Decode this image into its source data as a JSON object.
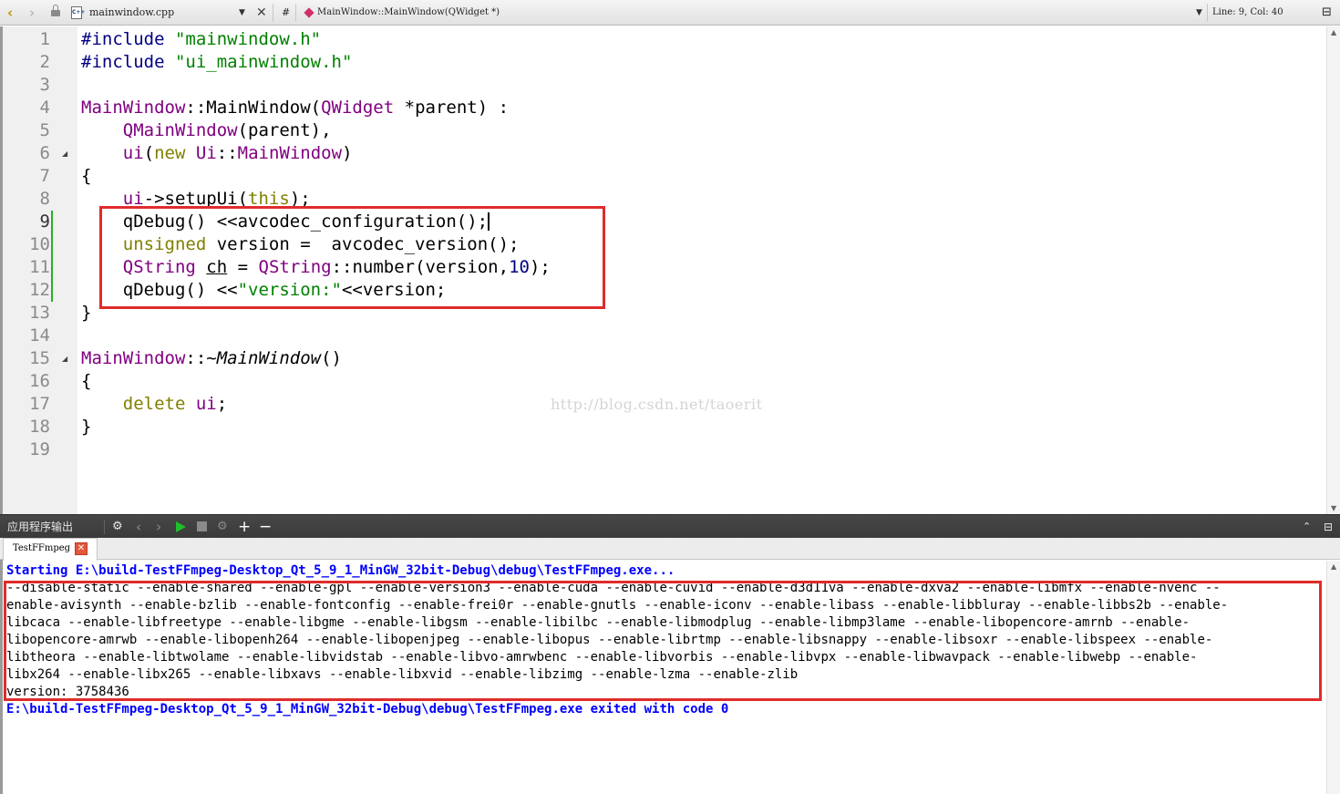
{
  "toolbar": {
    "file_name": "mainwindow.cpp",
    "file_icon_label": "C++",
    "hash": "#",
    "symbol": "MainWindow::MainWindow(QWidget *)",
    "cursor_position": "Line: 9, Col: 40"
  },
  "editor": {
    "line_numbers": [
      "1",
      "2",
      "3",
      "4",
      "5",
      "6",
      "7",
      "8",
      "9",
      "10",
      "11",
      "12",
      "13",
      "14",
      "15",
      "16",
      "17",
      "18",
      "19"
    ],
    "current_line": "9",
    "lines": [
      [
        {
          "t": "#include ",
          "c": "pp"
        },
        {
          "t": "\"mainwindow.h\"",
          "c": "str"
        }
      ],
      [
        {
          "t": "#include ",
          "c": "pp"
        },
        {
          "t": "\"ui_mainwindow.h\"",
          "c": "str"
        }
      ],
      [],
      [
        {
          "t": "MainWindow",
          "c": "ty"
        },
        {
          "t": "::MainWindow(",
          "c": ""
        },
        {
          "t": "QWidget",
          "c": "ty"
        },
        {
          "t": " *parent) :",
          "c": ""
        }
      ],
      [
        {
          "t": "    ",
          "c": ""
        },
        {
          "t": "QMainWindow",
          "c": "ty"
        },
        {
          "t": "(parent),",
          "c": ""
        }
      ],
      [
        {
          "t": "    ",
          "c": ""
        },
        {
          "t": "ui",
          "c": "ty"
        },
        {
          "t": "(",
          "c": ""
        },
        {
          "t": "new",
          "c": "kw"
        },
        {
          "t": " ",
          "c": ""
        },
        {
          "t": "Ui",
          "c": "ty"
        },
        {
          "t": "::",
          "c": ""
        },
        {
          "t": "MainWindow",
          "c": "ty"
        },
        {
          "t": ")",
          "c": ""
        }
      ],
      [
        {
          "t": "{",
          "c": ""
        }
      ],
      [
        {
          "t": "    ",
          "c": ""
        },
        {
          "t": "ui",
          "c": "ty"
        },
        {
          "t": "->setupUi(",
          "c": ""
        },
        {
          "t": "this",
          "c": "kw"
        },
        {
          "t": ");",
          "c": ""
        }
      ],
      [
        {
          "t": "    qDebug() <<avcodec_configuration();",
          "c": ""
        },
        {
          "t": "",
          "c": "caret"
        }
      ],
      [
        {
          "t": "    ",
          "c": ""
        },
        {
          "t": "unsigned",
          "c": "kw"
        },
        {
          "t": " version =  avcodec_version();",
          "c": ""
        }
      ],
      [
        {
          "t": "    ",
          "c": ""
        },
        {
          "t": "QString",
          "c": "ty"
        },
        {
          "t": " ",
          "c": ""
        },
        {
          "t": "ch",
          "c": "ul"
        },
        {
          "t": " = ",
          "c": ""
        },
        {
          "t": "QString",
          "c": "ty"
        },
        {
          "t": "::number(version,",
          "c": ""
        },
        {
          "t": "10",
          "c": "num"
        },
        {
          "t": ");",
          "c": ""
        }
      ],
      [
        {
          "t": "    qDebug() <<",
          "c": ""
        },
        {
          "t": "\"version:\"",
          "c": "str"
        },
        {
          "t": "<<version;",
          "c": ""
        }
      ],
      [
        {
          "t": "}",
          "c": ""
        }
      ],
      [],
      [
        {
          "t": "MainWindow",
          "c": "ty"
        },
        {
          "t": "::~",
          "c": ""
        },
        {
          "t": "MainWindow",
          "c": "it"
        },
        {
          "t": "()",
          "c": ""
        }
      ],
      [
        {
          "t": "{",
          "c": ""
        }
      ],
      [
        {
          "t": "    ",
          "c": ""
        },
        {
          "t": "delete",
          "c": "kw"
        },
        {
          "t": " ",
          "c": ""
        },
        {
          "t": "ui",
          "c": "ty"
        },
        {
          "t": ";",
          "c": ""
        }
      ],
      [
        {
          "t": "}",
          "c": ""
        }
      ],
      []
    ],
    "watermark": "http://blog.csdn.net/taoerit"
  },
  "output_pane": {
    "title": "应用程序输出",
    "tab_label": "TestFFmpeg",
    "lines": [
      {
        "text": "Starting E:\\build-TestFFmpeg-Desktop_Qt_5_9_1_MinGW_32bit-Debug\\debug\\TestFFmpeg.exe...",
        "kind": "status"
      },
      {
        "text": "--disable-static --enable-shared --enable-gpl --enable-version3 --enable-cuda --enable-cuvid --enable-d3d11va --enable-dxva2 --enable-libmfx --enable-nvenc --",
        "kind": "normal"
      },
      {
        "text": "enable-avisynth --enable-bzlib --enable-fontconfig --enable-frei0r --enable-gnutls --enable-iconv --enable-libass --enable-libbluray --enable-libbs2b --enable-",
        "kind": "normal"
      },
      {
        "text": "libcaca --enable-libfreetype --enable-libgme --enable-libgsm --enable-libilbc --enable-libmodplug --enable-libmp3lame --enable-libopencore-amrnb --enable-",
        "kind": "normal"
      },
      {
        "text": "libopencore-amrwb --enable-libopenh264 --enable-libopenjpeg --enable-libopus --enable-librtmp --enable-libsnappy --enable-libsoxr --enable-libspeex --enable-",
        "kind": "normal"
      },
      {
        "text": "libtheora --enable-libtwolame --enable-libvidstab --enable-libvo-amrwbenc --enable-libvorbis --enable-libvpx --enable-libwavpack --enable-libwebp --enable-",
        "kind": "normal"
      },
      {
        "text": "libx264 --enable-libx265 --enable-libxavs --enable-libxvid --enable-libzimg --enable-lzma --enable-zlib",
        "kind": "normal"
      },
      {
        "text": "version: 3758436",
        "kind": "normal"
      },
      {
        "text": "E:\\build-TestFFmpeg-Desktop_Qt_5_9_1_MinGW_32bit-Debug\\debug\\TestFFmpeg.exe exited with code 0",
        "kind": "status"
      }
    ]
  },
  "annotation_color": "#e02b2b"
}
